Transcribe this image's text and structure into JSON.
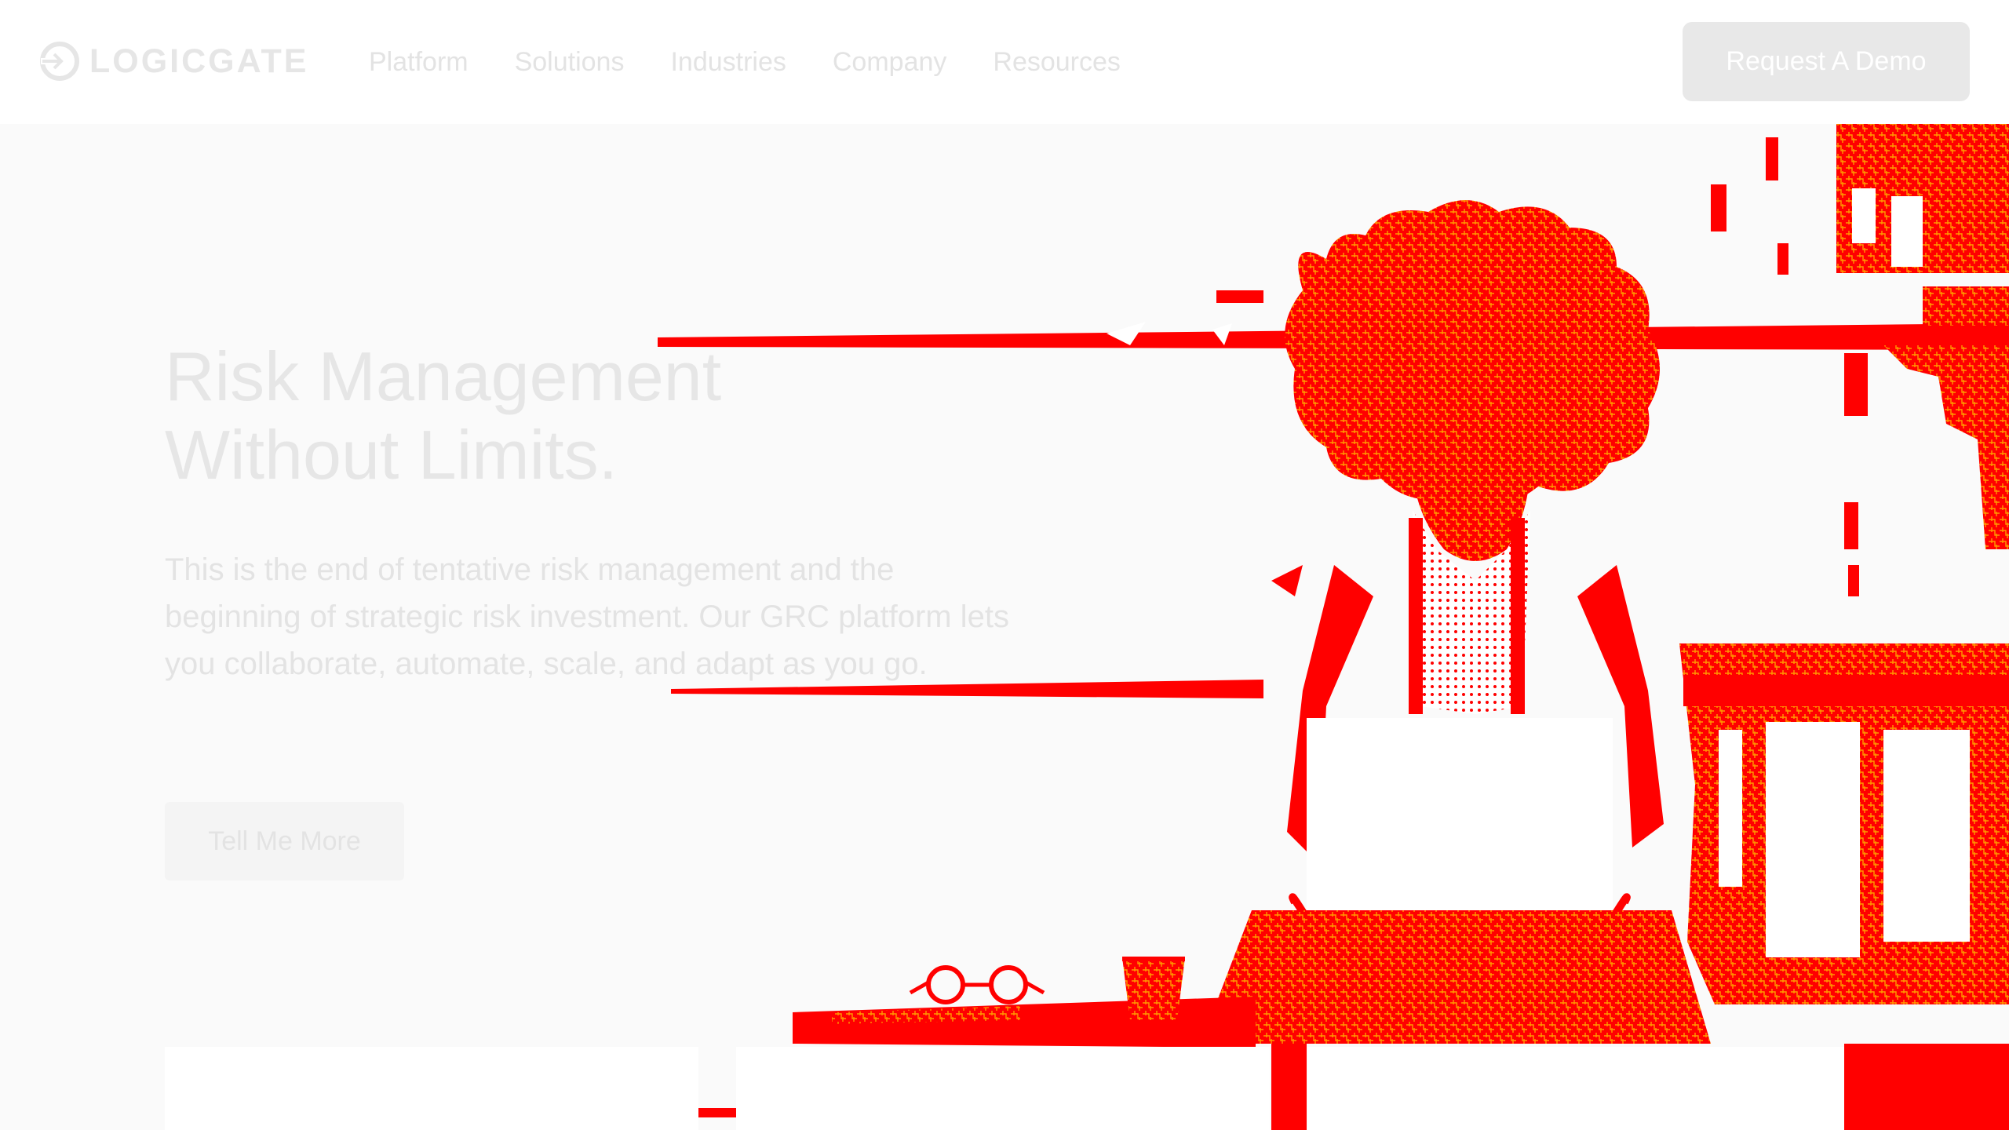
{
  "brand": {
    "logo_text": "LOGICGATE",
    "accent_color": "#ff0000",
    "accent_secondary": "#ff9a00"
  },
  "nav": {
    "items": [
      {
        "label": "Platform"
      },
      {
        "label": "Solutions"
      },
      {
        "label": "Industries"
      },
      {
        "label": "Company"
      },
      {
        "label": "Resources"
      }
    ],
    "cta_label": "Request A Demo"
  },
  "hero": {
    "headline_line1": "Risk Management",
    "headline_line2": "Without Limits.",
    "body": "This is the end of tentative risk management and the beginning of strategic risk investment. Our GRC platform lets you collaborate, automate, scale, and adapt as you go.",
    "button_label": "Tell Me More",
    "image_subject": "person-working-on-laptop-at-desk"
  }
}
